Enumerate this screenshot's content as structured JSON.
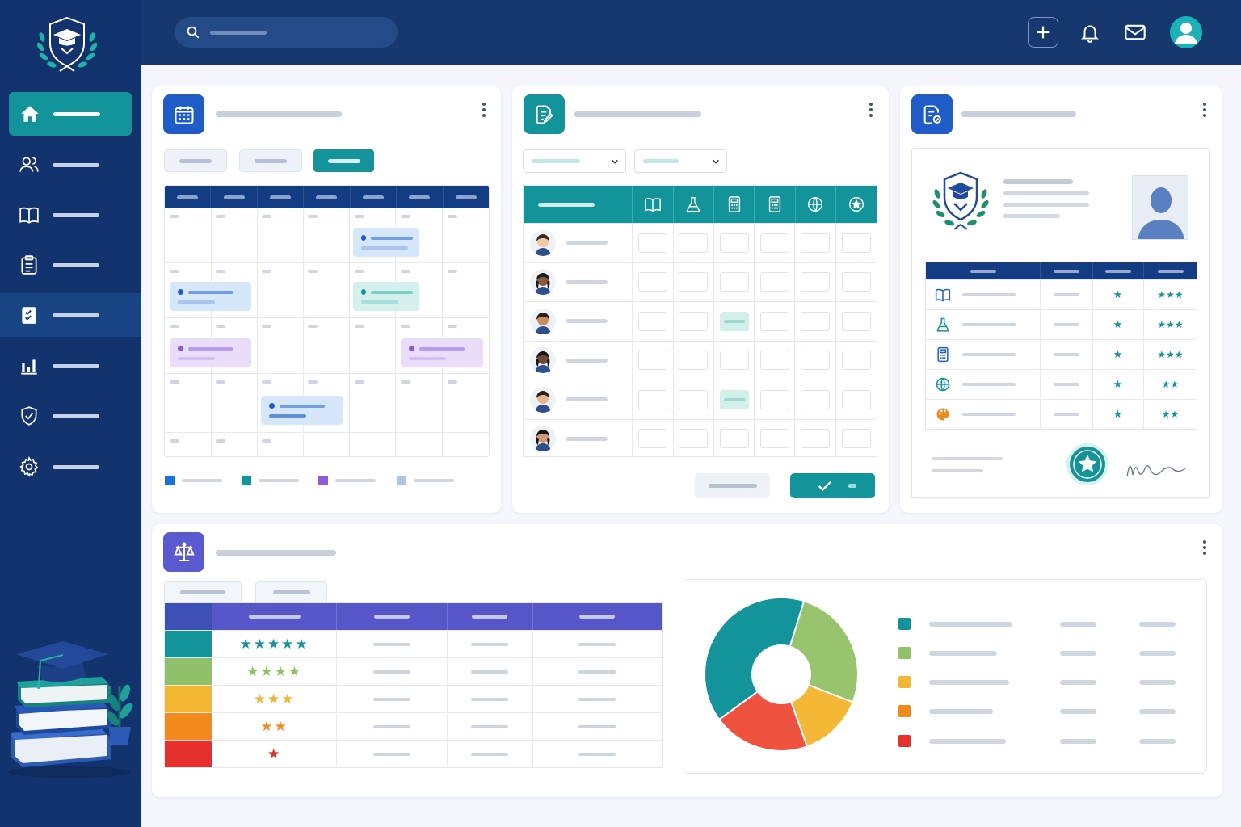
{
  "sidebar": {
    "logo_icon": "graduation-shield-logo",
    "items": [
      {
        "icon": "home-icon",
        "active": true
      },
      {
        "icon": "users-icon"
      },
      {
        "icon": "book-icon"
      },
      {
        "icon": "clipboard-icon"
      },
      {
        "icon": "checklist-icon",
        "highlighted": true
      },
      {
        "icon": "bar-chart-icon"
      },
      {
        "icon": "shield-check-icon"
      },
      {
        "icon": "gear-icon"
      }
    ],
    "illustration": "books-graduation-cap"
  },
  "topbar": {
    "actions": [
      "plus-icon",
      "bell-icon",
      "mail-icon",
      "user-avatar"
    ]
  },
  "calendar_card": {
    "icon": "calendar-icon",
    "filters": 3,
    "legend_colors": [
      "#1f6fd8",
      "#13949a",
      "#8a5cd6",
      "#b5c3e3"
    ]
  },
  "grades_card": {
    "icon": "edit-document-icon",
    "subject_icons": [
      "book-icon",
      "flask-icon",
      "calculator-icon",
      "calculator-icon",
      "globe-icon",
      "star-badge-icon"
    ],
    "students": 6,
    "confirm_icon": "check-icon"
  },
  "report_card": {
    "icon": "certificate-icon",
    "subject_icons": [
      "book-icon",
      "flask-icon",
      "calculator-icon",
      "globe-icon",
      "palette-icon"
    ],
    "ratings": [
      "★",
      "★",
      "★",
      "★",
      "★"
    ],
    "grades": [
      "★★★",
      "★★★",
      "★★★",
      "★★",
      "★★"
    ],
    "seal_icon": "star-seal-icon"
  },
  "rubric_card": {
    "icon": "scales-icon",
    "levels": [
      {
        "color": "#13949a",
        "stars": "★★★★★"
      },
      {
        "color": "#8fc06a",
        "stars": "★★★★"
      },
      {
        "color": "#f2b632",
        "stars": "★★★"
      },
      {
        "color": "#f28a1e",
        "stars": "★★"
      },
      {
        "color": "#e5302e",
        "stars": "★"
      }
    ],
    "distribution": [
      {
        "color": "#13949a",
        "value": 35
      },
      {
        "color": "#97c46d",
        "value": 23
      },
      {
        "color": "#f4b836",
        "value": 12
      },
      {
        "color": "#ef5340",
        "value": 18
      },
      {
        "color": "#13949a",
        "value": 0
      }
    ],
    "legend_colors": [
      "#13949a",
      "#8fc06a",
      "#f2b632",
      "#f28a1e",
      "#e5302e"
    ]
  }
}
